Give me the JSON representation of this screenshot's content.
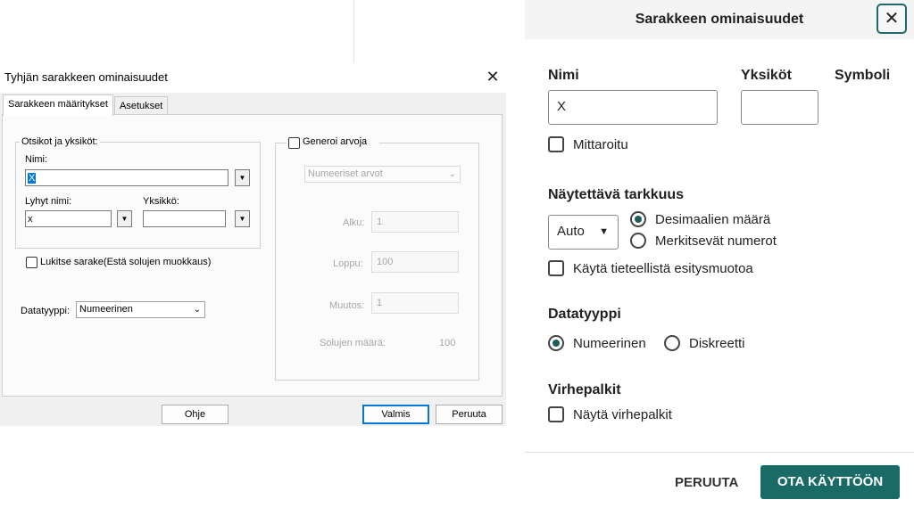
{
  "legacy_dialog": {
    "title": "Tyhjän sarakkeen ominaisuudet",
    "close_glyph": "✕",
    "tabs": [
      "Sarakkeen määritykset",
      "Asetukset"
    ],
    "headers_group": {
      "label": "Otsikot ja yksiköt:",
      "name_label": "Nimi:",
      "name_value": "X",
      "short_name_label": "Lyhyt nimi:",
      "short_name_value": "x",
      "unit_label": "Yksikkö:",
      "unit_value": ""
    },
    "lock_column_label": "Lukitse sarake(Estä solujen muokkaus)",
    "datatype_label": "Datatyyppi:",
    "datatype_value": "Numeerinen",
    "generate_group": {
      "label": "Generoi arvoja",
      "type_value": "Numeeriset arvot",
      "start_label": "Alku:",
      "start_value": "1",
      "end_label": "Loppu:",
      "end_value": "100",
      "step_label": "Muutos:",
      "step_value": "1",
      "count_label": "Solujen määrä:",
      "count_value": "100"
    },
    "buttons": {
      "help": "Ohje",
      "ok": "Valmis",
      "cancel": "Peruuta"
    }
  },
  "modern_panel": {
    "title": "Sarakkeen ominaisuudet",
    "close_glyph": "✕",
    "name_label": "Nimi",
    "name_value": "X",
    "units_label": "Yksiköt",
    "units_value": "",
    "symbol_label": "Symboli",
    "measured_label": "Mittaroitu",
    "precision_label": "Näytettävä tarkkuus",
    "precision_select": "Auto",
    "precision_options": [
      "Desimaalien määrä",
      "Merkitsevät numerot"
    ],
    "precision_selected": "Desimaalien määrä",
    "scientific_label": "Käytä tieteellistä esitysmuotoa",
    "datatype_label": "Datatyyppi",
    "datatype_options": [
      "Numeerinen",
      "Diskreetti"
    ],
    "datatype_selected": "Numeerinen",
    "errorbars_label": "Virhepalkit",
    "show_errorbars_label": "Näytä virhepalkit",
    "cancel_button": "PERUUTA",
    "apply_button": "OTA KÄYTTÖÖN",
    "accent_color": "#1a6b66"
  }
}
